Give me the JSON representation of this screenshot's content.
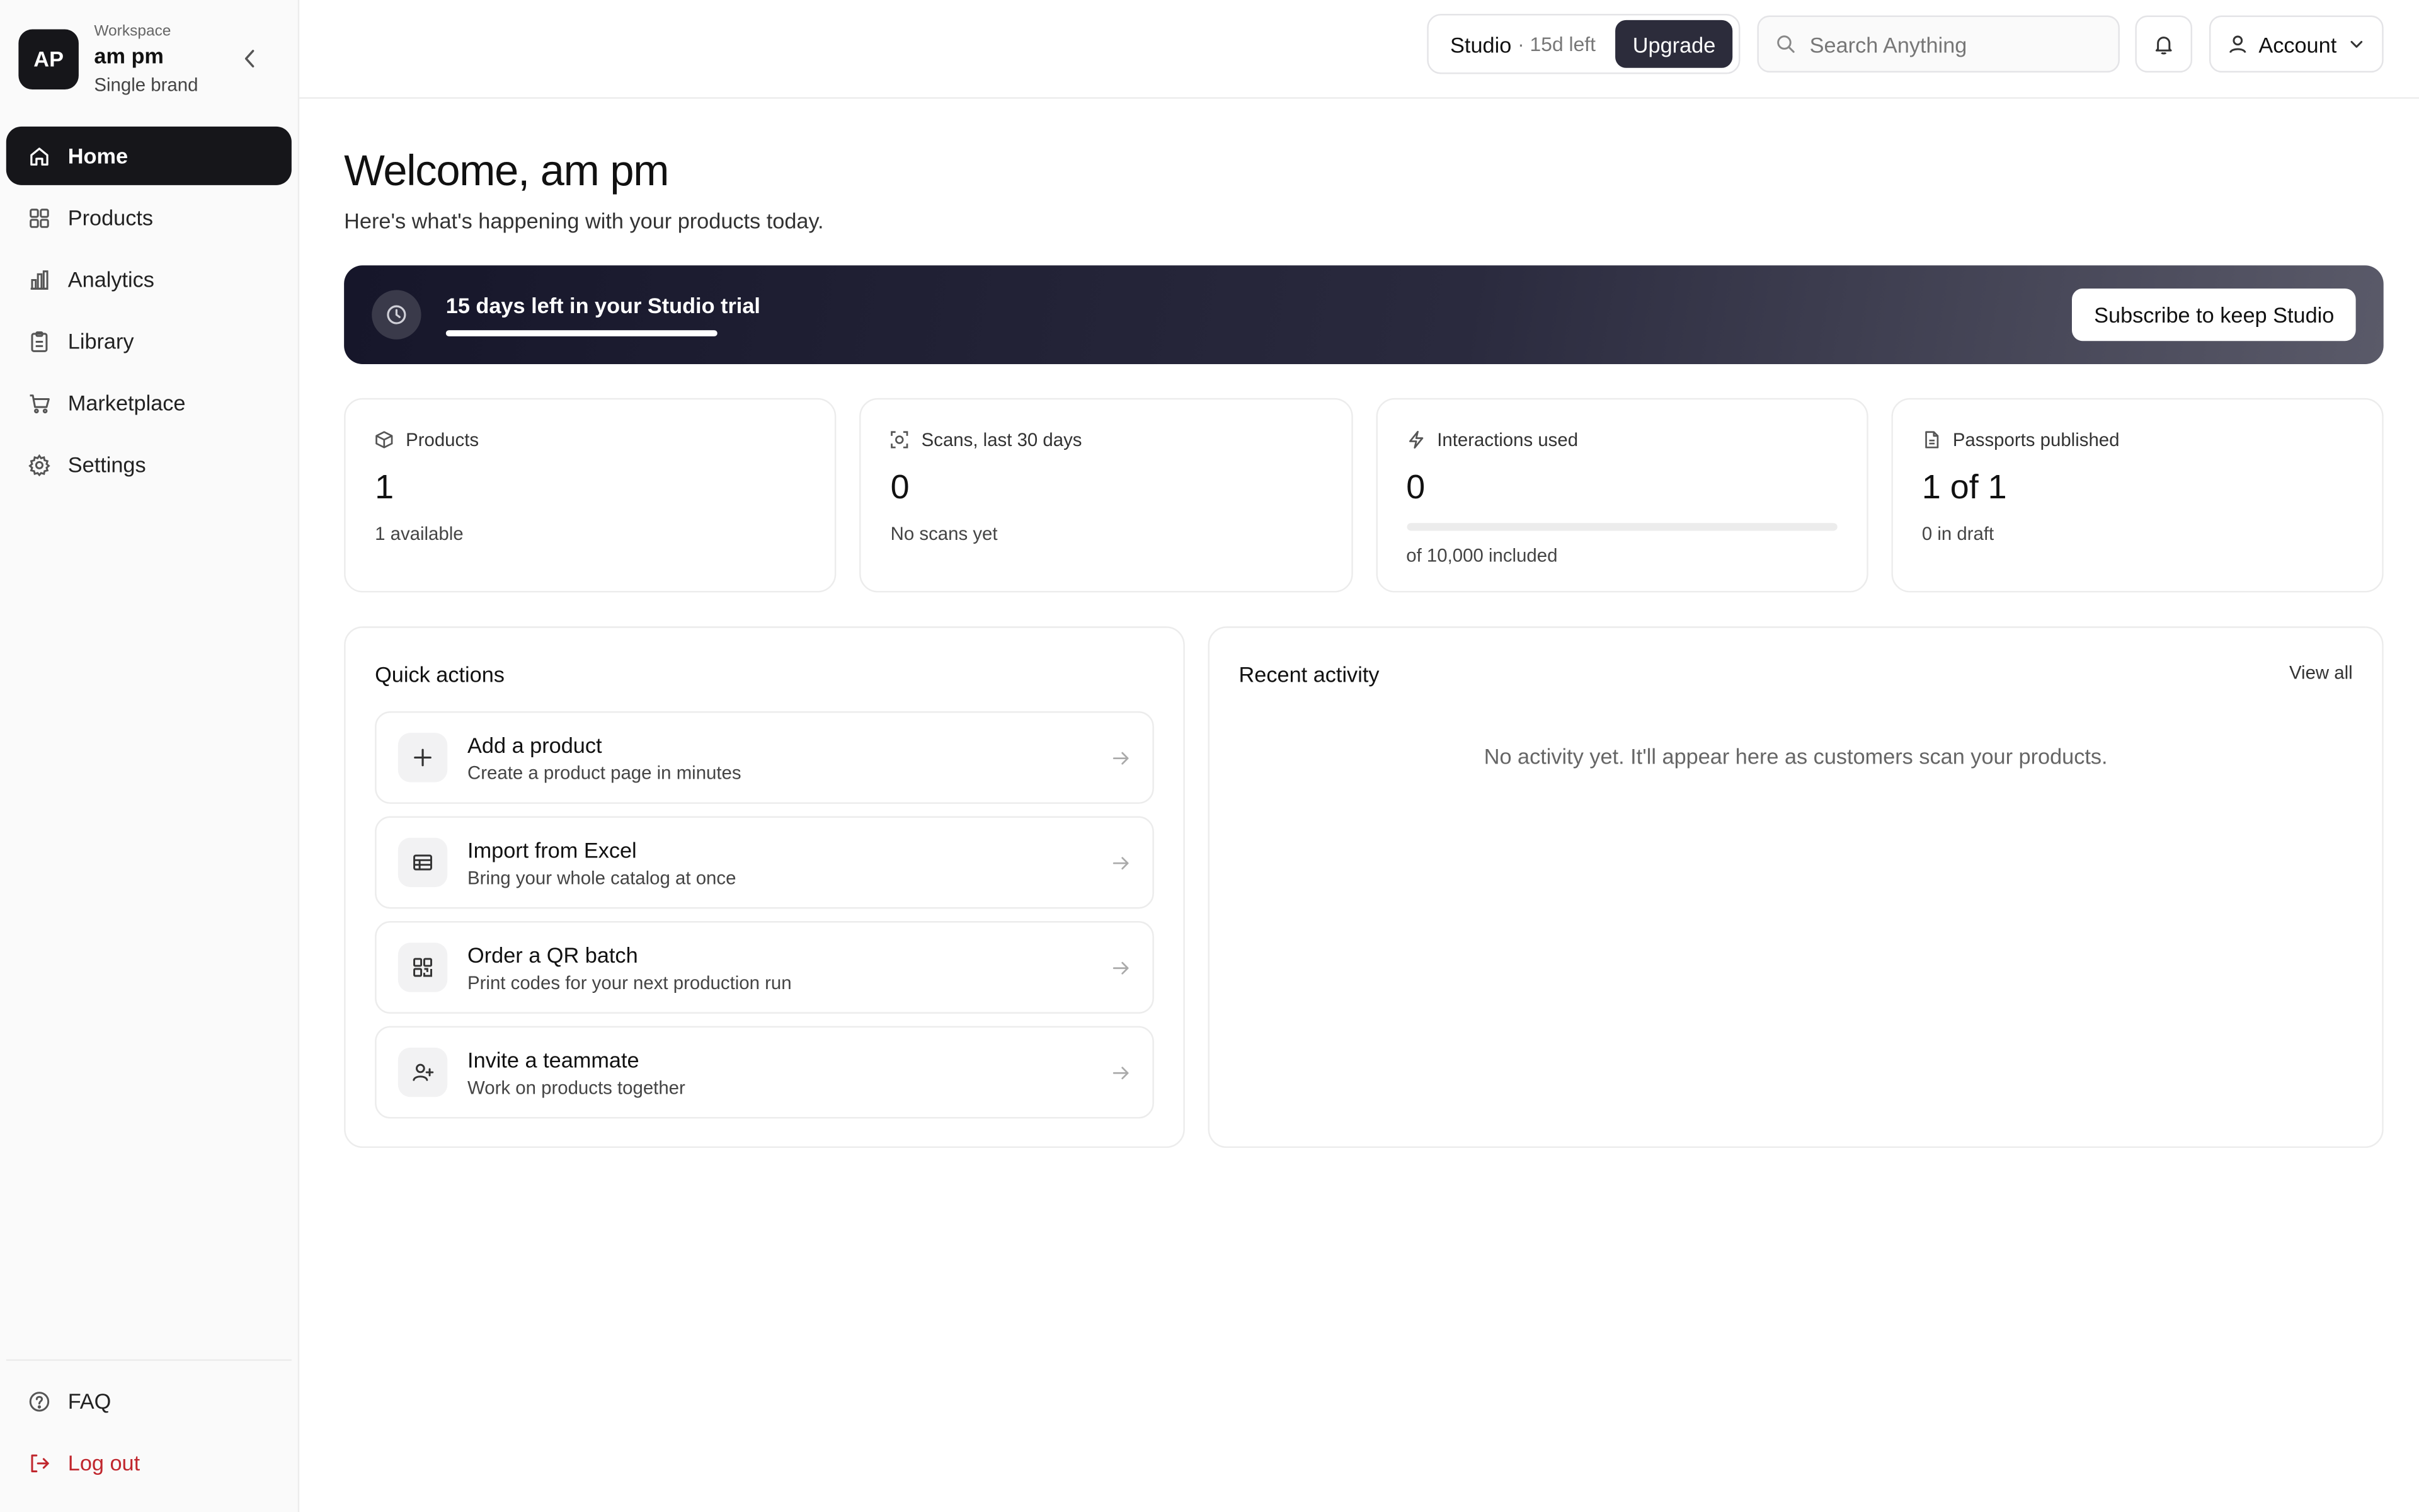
{
  "sidebar": {
    "workspace": {
      "initials": "AP",
      "label": "Workspace",
      "name": "am pm",
      "plan": "Single brand"
    },
    "items": [
      {
        "label": "Home",
        "icon": "home-icon",
        "active": true
      },
      {
        "label": "Products",
        "icon": "grid-icon"
      },
      {
        "label": "Analytics",
        "icon": "bar-chart-icon"
      },
      {
        "label": "Library",
        "icon": "clipboard-icon"
      },
      {
        "label": "Marketplace",
        "icon": "cart-icon"
      },
      {
        "label": "Settings",
        "icon": "gear-icon"
      }
    ],
    "bottom": [
      {
        "label": "FAQ",
        "icon": "help-circle-icon"
      },
      {
        "label": "Log out",
        "icon": "logout-icon"
      }
    ]
  },
  "topbar": {
    "plan": "Studio",
    "days_left": "· 15d left",
    "upgrade_label": "Upgrade",
    "search_placeholder": "Search Anything",
    "account_label": "Account"
  },
  "main": {
    "welcome": "Welcome, am pm",
    "subtitle": "Here's what's happening with your products today.",
    "banner": {
      "title": "15 days left in your Studio trial",
      "progress": 1.0,
      "button_label": "Subscribe to keep Studio"
    },
    "stats": [
      {
        "label": "Products",
        "icon": "box-icon",
        "value": "1",
        "sub": "1 available"
      },
      {
        "label": "Scans, last 30 days",
        "icon": "scan-icon",
        "value": "0",
        "sub": "No scans yet"
      },
      {
        "label": "Interactions used",
        "icon": "bolt-icon",
        "value": "0",
        "sub": "of 10,000 included",
        "progress": 0
      },
      {
        "label": "Passports published",
        "icon": "document-icon",
        "value": "1 of 1",
        "sub": "0 in draft"
      }
    ],
    "quick_actions": {
      "title": "Quick actions",
      "items": [
        {
          "title": "Add a product",
          "sub": "Create a product page in minutes",
          "icon": "plus-icon"
        },
        {
          "title": "Import from Excel",
          "sub": "Bring your whole catalog at once",
          "icon": "table-icon"
        },
        {
          "title": "Order a QR batch",
          "sub": "Print codes for your next production run",
          "icon": "qr-icon"
        },
        {
          "title": "Invite a teammate",
          "sub": "Work on products together",
          "icon": "user-plus-icon"
        }
      ]
    },
    "recent_activity": {
      "title": "Recent activity",
      "view_all_label": "View all",
      "empty_text": "No activity yet. It'll appear here as customers scan your products."
    }
  },
  "colors": {
    "dark": "#16161a",
    "accent": "#2c2c3b",
    "danger": "#c0262d",
    "border": "#ececec"
  }
}
